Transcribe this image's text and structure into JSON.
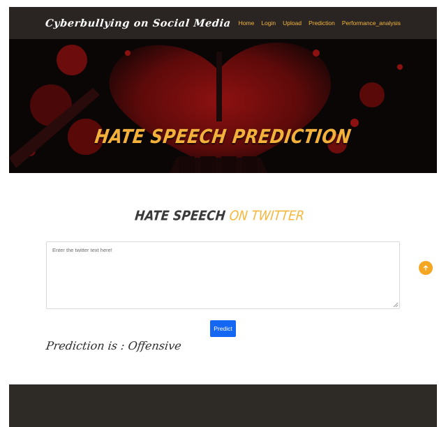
{
  "header": {
    "brand": "Cyberbullying on Social Media",
    "nav": [
      {
        "label": "Home"
      },
      {
        "label": "Login"
      },
      {
        "label": "Upload"
      },
      {
        "label": "Prediction"
      },
      {
        "label": "Performance_analysis"
      }
    ]
  },
  "hero": {
    "title": "HATE SPEECH PREDICTION"
  },
  "main": {
    "title_part1": "HATE SPEECH ",
    "title_part2": "ON TWITTER",
    "input": {
      "placeholder": "Enter the twitter text here!",
      "value": ""
    },
    "predict_label": "Predict",
    "result_text": "Prediction is : Offensive"
  },
  "colors": {
    "accent": "#f5b73b",
    "button": "#1467f2",
    "navbar": "#2a2522",
    "footer": "#2e2a26",
    "scroll_top": "#f5a623"
  },
  "icons": {
    "scroll_top": "arrow-up-icon"
  }
}
